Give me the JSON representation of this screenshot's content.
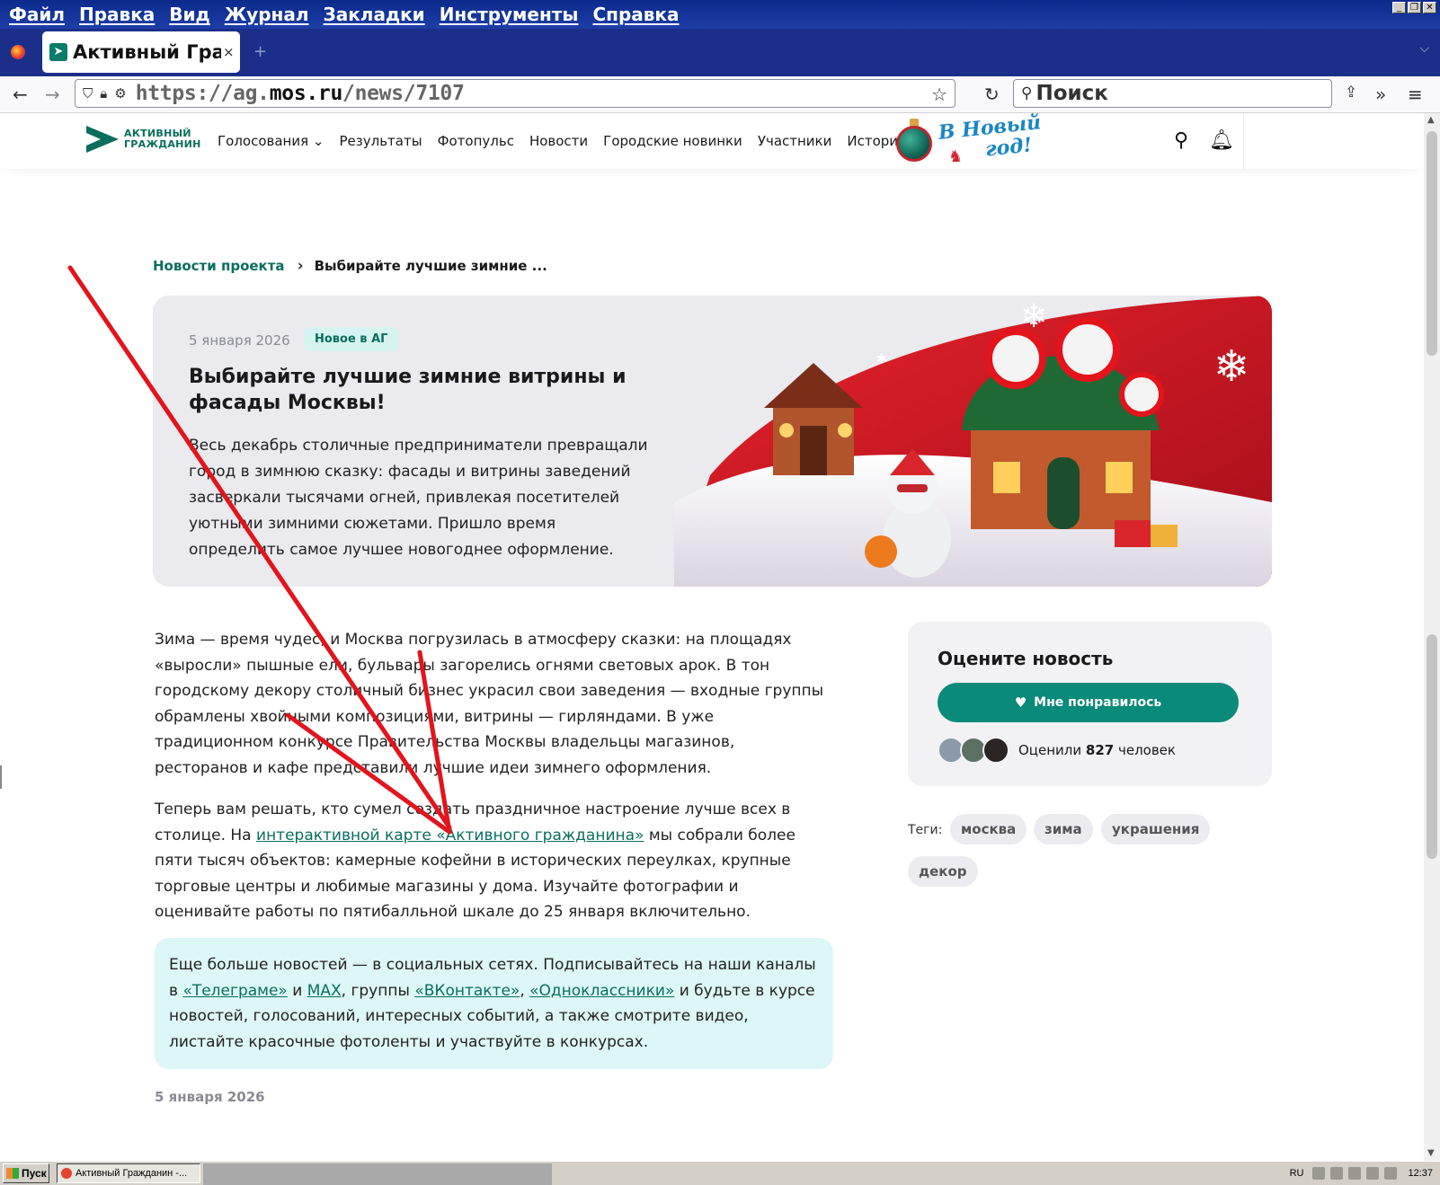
{
  "browser": {
    "menu": [
      "Файл",
      "Правка",
      "Вид",
      "Журнал",
      "Закладки",
      "Инструменты",
      "Справка"
    ],
    "tab_title": "Активный Граж",
    "tab_close": "×",
    "new_tab": "+",
    "url_host_prefix": "https://ag.",
    "url_host_main": "mos.ru",
    "url_path": "/news/7107",
    "search_placeholder": "Поиск"
  },
  "site": {
    "logo_line1": "АКТИВНЫЙ",
    "logo_line2": "ГРАЖДАНИН",
    "nav": [
      "Голосования",
      "Результаты",
      "Фотопульс",
      "Новости",
      "Городские новинки",
      "Участники",
      "Истории"
    ],
    "promo_line1": "В Новый",
    "promo_line2": "год!"
  },
  "breadcrumb": {
    "parent": "Новости проекта",
    "current": "Выбирайте лучшие зимние ..."
  },
  "hero": {
    "date": "5 января 2026",
    "badge": "Новое в АГ",
    "title": "Выбирайте лучшие зимние витрины и фасады Москвы!",
    "lead": "Весь декабрь столичные предприниматели превращали город в зимнюю сказку: фасады и витрины заведений засверкали тысячами огней, привлекая посетителей уютными зимними сюжетами. Пришло время определить самое лучшее новогоднее оформление."
  },
  "article": {
    "p1": "Зима — время чудес, и Москва погрузилась в атмосферу сказки: на площадях «выросли» пышные ели, бульвары загорелись огнями световых арок. В тон городскому декору столичный бизнес украсил свои заведения — входные группы обрамлены хвойными композициями, витрины — гирляндами. В уже традиционном конкурсе Правительства Москвы владельцы магазинов, ресторанов и кафе представили лучшие идеи зимнего оформления.",
    "p2_before": "Теперь вам решать, кто сумел создать праздничное настроение лучше всех в столице. На ",
    "p2_link": "интерактивной карте «Активного гражданина»",
    "p2_after": " мы собрали более пяти тысяч объектов: камерные кофейни в исторических переулках, крупные торговые центры и любимые магазины у дома. Изучайте фотографии и оценивайте работы по пятибалльной шкале до 25 января включительно.",
    "callout_1": "Еще больше новостей — в социальных сетях. Подписывайтесь на наши каналы в ",
    "link_telegram": "«Телеграме»",
    "callout_and": " и ",
    "link_max": "MAX",
    "callout_groups": ", группы ",
    "link_vk": "«ВКонтакте»",
    "callout_comma": ", ",
    "link_ok": "«Одноклассники»",
    "callout_2": " и будьте в курсе новостей, голосований, интересных событий, а также смотрите видео, листайте красочные фотоленты и участвуйте в конкурсах.",
    "footer_date": "5 января 2026"
  },
  "rating": {
    "title": "Оцените новость",
    "like_label": "Мне понравилось",
    "rated_prefix": "Оценили ",
    "rated_count": "827",
    "rated_suffix": " человек"
  },
  "tags": {
    "label": "Теги:",
    "items": [
      "москва",
      "зима",
      "украшения",
      "декор"
    ]
  },
  "taskbar": {
    "start": "Пуск",
    "task": "Активный Гражданин -...",
    "lang": "RU",
    "clock": "12:37"
  },
  "colors": {
    "brand_green": "#0a6e5e",
    "button_green": "#0a8a78",
    "annotation_red": "#e3141b",
    "firefox_bar": "#1b2f8a"
  }
}
